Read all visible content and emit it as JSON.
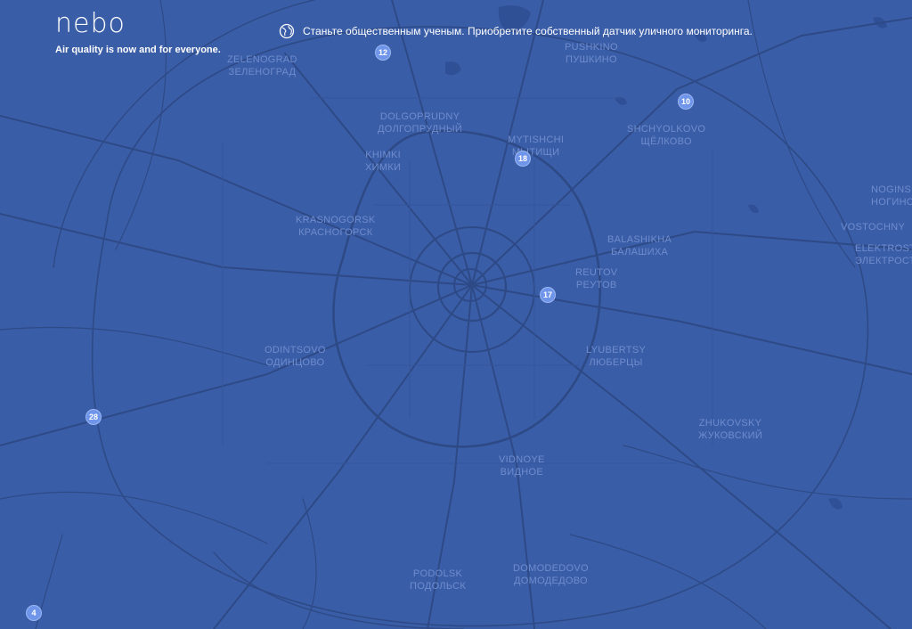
{
  "brand": {
    "logo": "nebo",
    "tagline": "Air quality is now and for everyone."
  },
  "promo": {
    "icon": "globe-icon",
    "text": "Станьте общественным ученым. Приобретите собственный датчик уличного мониторинга."
  },
  "colors": {
    "background": "#3a5da8",
    "roads": "#2e4a86",
    "label": "#6f8ccc",
    "cluster": "#6f95ea"
  },
  "cities": [
    {
      "latin": "ZELENOGRAD",
      "cyrillic": "ЗЕЛЕНОГРАД"
    },
    {
      "latin": "PUSHKINO",
      "cyrillic": "ПУШКИНО"
    },
    {
      "latin": "DOLGOPRUDNY",
      "cyrillic": "ДОЛГОПРУДНЫЙ"
    },
    {
      "latin": "MYTISHCHI",
      "cyrillic": "МЫТИЩИ"
    },
    {
      "latin": "SHCHYOLKOVO",
      "cyrillic": "ЩЁЛКОВО"
    },
    {
      "latin": "KHIMKI",
      "cyrillic": "ХИМКИ"
    },
    {
      "latin": "KRASNOGORSK",
      "cyrillic": "КРАСНОГОРСК"
    },
    {
      "latin": "BALASHIKHA",
      "cyrillic": "БАЛАШИХА"
    },
    {
      "latin": "REUTOV",
      "cyrillic": "РЕУТОВ"
    },
    {
      "latin": "ODINTSOVO",
      "cyrillic": "ОДИНЦОВО"
    },
    {
      "latin": "LYUBERTSY",
      "cyrillic": "ЛЮБЕРЦЫ"
    },
    {
      "latin": "ZHUKOVSKY",
      "cyrillic": "ЖУКОВСКИЙ"
    },
    {
      "latin": "VIDNOYE",
      "cyrillic": "ВИДНОЕ"
    },
    {
      "latin": "PODOLSK",
      "cyrillic": "ПОДОЛЬСК"
    },
    {
      "latin": "DOMODEDOVO",
      "cyrillic": "ДОМОДЕДОВО"
    },
    {
      "latin": "NOGINSK",
      "cyrillic": "НОГИНСК"
    },
    {
      "latin": "VOSTOCHNY",
      "cyrillic": ""
    },
    {
      "latin": "ELEKTROSTAL",
      "cyrillic": "ЭЛЕКТРОСТАЛЬ"
    }
  ],
  "clusters": [
    "12",
    "10",
    "18",
    "17",
    "28",
    "4"
  ]
}
